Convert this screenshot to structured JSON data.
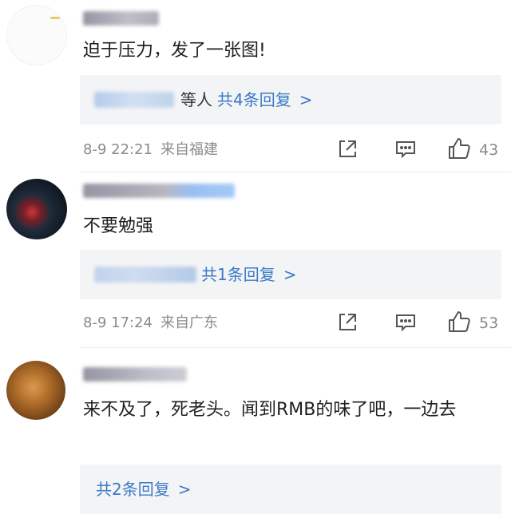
{
  "comments": [
    {
      "text": "迫于压力，发了一张图!",
      "reply_suffix": "等人",
      "reply_count": "共4条回复",
      "reply_chevron": ">",
      "time": "8-9 22:21",
      "location": "来自福建",
      "likes": "43"
    },
    {
      "text": "不要勉强",
      "reply_suffix": "",
      "reply_count": "共1条回复",
      "reply_chevron": ">",
      "time": "8-9 17:24",
      "location": "来自广东",
      "likes": "53"
    },
    {
      "text": "来不及了，死老头。闻到RMB的味了吧，一边去",
      "reply_suffix": "",
      "reply_count": "共2条回复",
      "reply_chevron": ">"
    }
  ],
  "icons": {
    "share": "share-icon",
    "comment": "comment-icon",
    "like": "thumbs-up-icon"
  },
  "colors": {
    "link": "#3a79c6",
    "reply_bg": "#f3f4f6",
    "meta": "#8a8a8a"
  }
}
